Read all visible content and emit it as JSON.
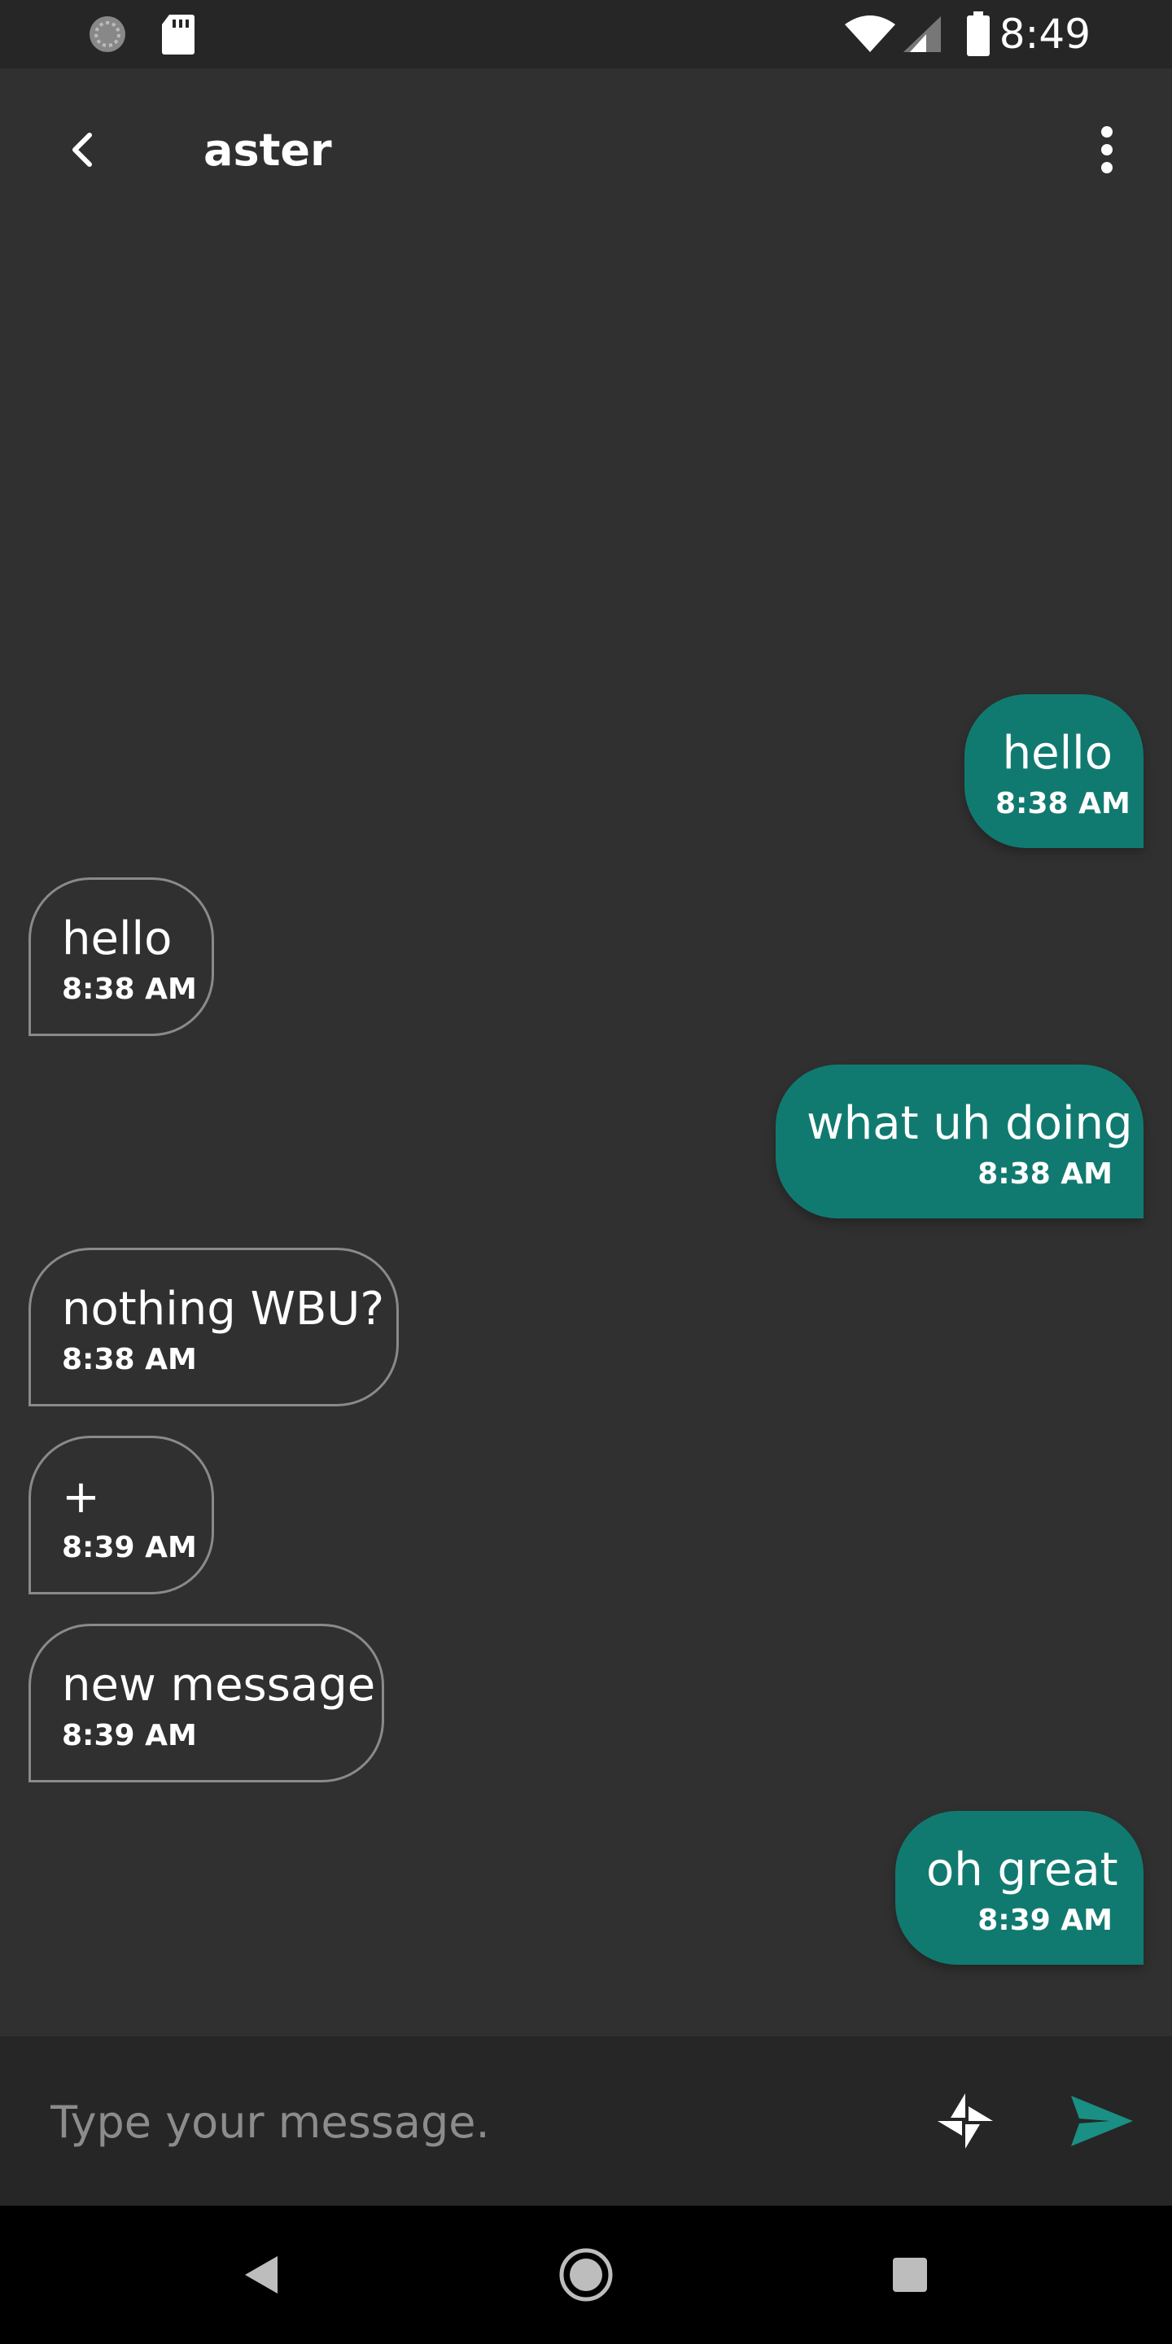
{
  "status_bar": {
    "time": "8:49",
    "icons": [
      "sync-icon",
      "sd-card-icon",
      "wifi-icon",
      "signal-icon",
      "battery-icon"
    ]
  },
  "header": {
    "title": "aster",
    "icons": [
      "back-arrow-icon",
      "more-vert-icon"
    ]
  },
  "messages": [
    {
      "direction": "outgoing",
      "text": "hello",
      "time": "8:38 AM"
    },
    {
      "direction": "incoming",
      "text": "hello",
      "time": "8:38 AM"
    },
    {
      "direction": "outgoing",
      "text": "what uh doing",
      "time": "8:38 AM"
    },
    {
      "direction": "incoming",
      "text": "nothing WBU?",
      "time": "8:38 AM"
    },
    {
      "direction": "incoming",
      "text": "+",
      "time": "8:39 AM"
    },
    {
      "direction": "incoming",
      "text": "new message",
      "time": "8:39 AM"
    },
    {
      "direction": "outgoing",
      "text": "oh great",
      "time": "8:39 AM"
    }
  ],
  "composer": {
    "placeholder": "Type your message.",
    "value": "",
    "icons": [
      "attach-icon",
      "send-icon"
    ]
  },
  "nav_bar": {
    "icons": [
      "nav-back-icon",
      "nav-home-icon",
      "nav-recents-icon"
    ]
  },
  "colors": {
    "background": "#303030",
    "outgoing_bubble": "#117a70",
    "incoming_border": "#8a8a8a",
    "send_icon": "#1a8f84",
    "status_bar": "#262626"
  }
}
